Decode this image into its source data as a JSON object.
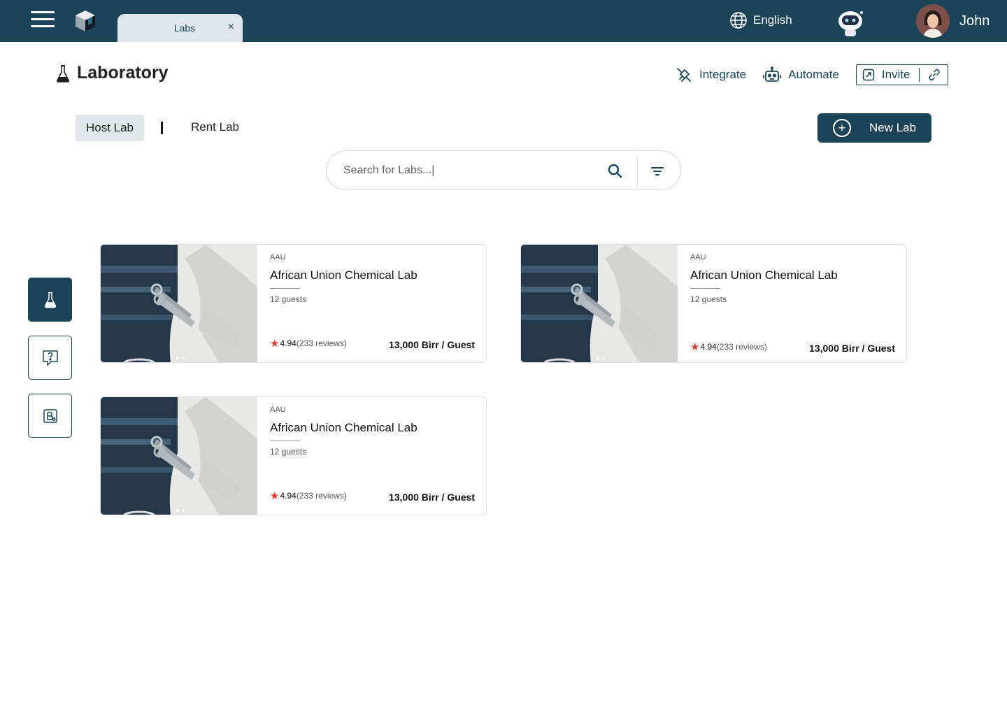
{
  "topbar": {
    "tab_label": "Labs",
    "tab_close": "×",
    "language": "English",
    "user_name": "John"
  },
  "header": {
    "title": "Laboratory",
    "integrate": "Integrate",
    "automate": "Automate",
    "invite": "Invite"
  },
  "segments": {
    "host": "Host Lab",
    "rent": "Rent Lab"
  },
  "new_lab": {
    "plus": "+",
    "label": "New Lab"
  },
  "search": {
    "placeholder": "Search for Labs...|"
  },
  "cards": [
    {
      "org": "AAU",
      "name": "African Union Chemical Lab",
      "guests": "12 guests",
      "rating": "4.94",
      "reviews": "(233 reviews)",
      "price": "13,000 Birr / Guest"
    },
    {
      "org": "AAU",
      "name": "African Union Chemical Lab",
      "guests": "12 guests",
      "rating": "4.94",
      "reviews": "(233 reviews)",
      "price": "13,000 Birr / Guest"
    },
    {
      "org": "AAU",
      "name": "African Union Chemical Lab",
      "guests": "12 guests",
      "rating": "4.94",
      "reviews": "(233 reviews)",
      "price": "13,000 Birr / Guest"
    }
  ],
  "colors": {
    "primary": "#1b4459",
    "tab_bg": "#dfe6ea",
    "star": "#e53935"
  },
  "icons": [
    "menu-icon",
    "app-logo",
    "close-icon",
    "globe-icon",
    "robot-assistant-icon",
    "flask-icon",
    "integrate-icon",
    "robot-icon",
    "invite-icon",
    "link-icon",
    "plus-circle-icon",
    "search-icon",
    "filter-icon",
    "help-chat-icon",
    "document-icon",
    "star-icon"
  ]
}
